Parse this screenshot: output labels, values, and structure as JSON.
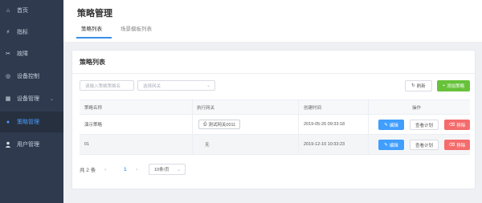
{
  "sidebar": {
    "items": [
      {
        "label": "首页",
        "icon": "home-icon",
        "glyph": "⌂"
      },
      {
        "label": "指标",
        "icon": "bolt-icon",
        "glyph": "⚡"
      },
      {
        "label": "故障",
        "icon": "tools-icon",
        "glyph": "✂"
      },
      {
        "label": "设备控制",
        "icon": "control-icon",
        "glyph": "◎"
      },
      {
        "label": "设备管理",
        "icon": "grid-icon",
        "glyph": "▦"
      },
      {
        "label": "策略管理",
        "icon": "dot-icon",
        "glyph": "●"
      },
      {
        "label": "用户管理",
        "icon": "user-icon",
        "glyph": "👤"
      }
    ]
  },
  "header": {
    "title": "策略管理",
    "tabs": [
      {
        "label": "策略列表"
      },
      {
        "label": "场景模板列表"
      }
    ]
  },
  "card": {
    "title": "策略列表",
    "filters": {
      "name_placeholder": "请输入策略策略名",
      "gateway_placeholder": "选择网关"
    },
    "refresh_label": "刷新",
    "add_label": "添加策略"
  },
  "table": {
    "columns": [
      "策略名称",
      "执行网关",
      "创建时间",
      "操作"
    ],
    "rows": [
      {
        "name": "演示策略",
        "gateway": "测试网关0011",
        "created": "2019-05-26 09:33:18"
      },
      {
        "name": "01",
        "gateway": "无",
        "created": "2019-12-10 10:33:23"
      }
    ],
    "actions": {
      "edit": "编辑",
      "view": "查看计划",
      "delete": "移除"
    }
  },
  "pagination": {
    "total": "共 2 条",
    "current_page": "1",
    "page_size": "10条/页"
  },
  "colors": {
    "sidebar_bg": "#2f3a4f",
    "accent": "#409eff",
    "success": "#67c23a",
    "danger": "#f56c6c"
  }
}
